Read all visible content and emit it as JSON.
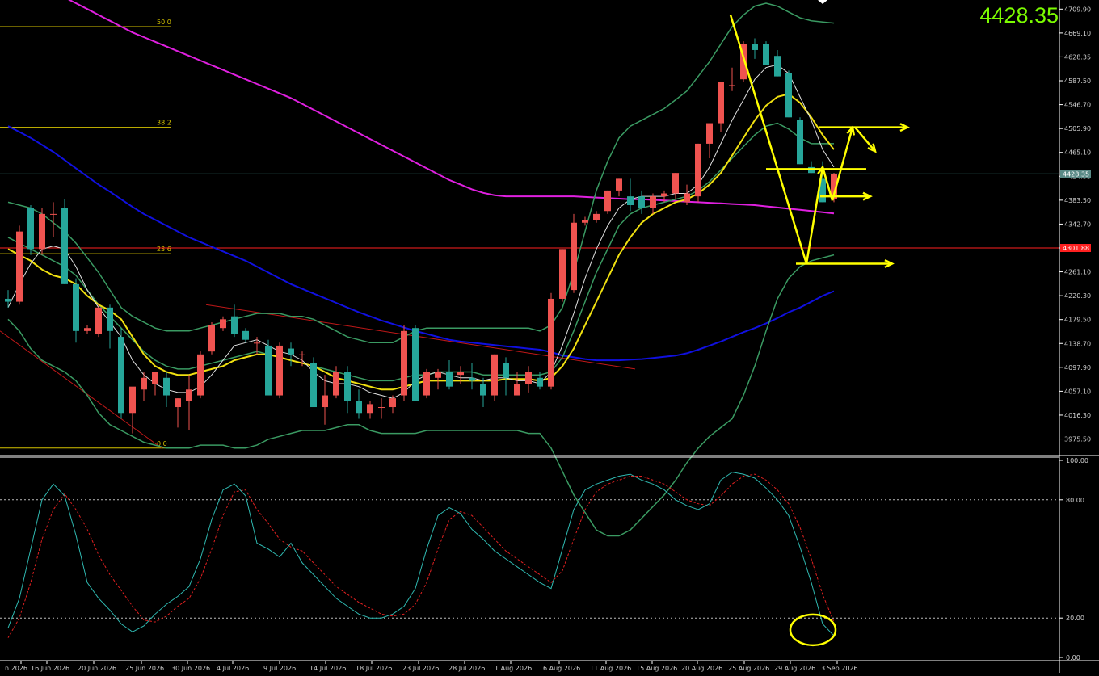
{
  "current_price": "4428.35",
  "chart_data": {
    "type": "candlestick",
    "price_axis": {
      "ticks": [
        "4709.90",
        "4669.10",
        "4628.35",
        "4587.50",
        "4546.70",
        "4505.90",
        "4465.10",
        "4424.35",
        "4383.50",
        "4342.70",
        "4301.90",
        "4261.10",
        "4220.30",
        "4179.50",
        "4138.70",
        "4097.90",
        "4057.10",
        "4016.30",
        "3975.50"
      ],
      "ylim": [
        3950,
        4720
      ]
    },
    "price_markers": {
      "current": {
        "label": "4428.35",
        "value": 4428.35,
        "color": "#4fb3a9"
      },
      "level": {
        "label": "4301.88",
        "value": 4301.88,
        "color": "#ff2020"
      }
    },
    "fib_levels": [
      {
        "label": "50.0",
        "value": 4680
      },
      {
        "label": "38.2",
        "value": 4508
      },
      {
        "label": "23.6",
        "value": 4292
      },
      {
        "label": "0.0",
        "value": 3960
      }
    ],
    "date_labels": [
      "n 2026",
      "16 Jun 2026",
      "20 Jun 2026",
      "25 Jun 2026",
      "30 Jun 2026",
      "4 Jul 2026",
      "9 Jul 2026",
      "14 Jul 2026",
      "18 Jul 2026",
      "23 Jul 2026",
      "28 Jul 2026",
      "1 Aug 2026",
      "6 Aug 2026",
      "11 Aug 2026",
      "15 Aug 2026",
      "20 Aug 2026",
      "25 Aug 2026",
      "29 Aug 2026",
      "3 Sep 2026"
    ],
    "candles": [
      [
        4215,
        4230,
        4200,
        4210
      ],
      [
        4210,
        4340,
        4205,
        4330
      ],
      [
        4370,
        4375,
        4290,
        4300
      ],
      [
        4300,
        4370,
        4290,
        4360
      ],
      [
        4360,
        4380,
        4320,
        4360
      ],
      [
        4370,
        4385,
        4240,
        4240
      ],
      [
        4240,
        4250,
        4140,
        4160
      ],
      [
        4160,
        4170,
        4155,
        4165
      ],
      [
        4155,
        4205,
        4150,
        4200
      ],
      [
        4200,
        4205,
        4130,
        4160
      ],
      [
        4150,
        4165,
        4010,
        4020
      ],
      [
        4020,
        4060,
        3985,
        4065
      ],
      [
        4060,
        4090,
        4040,
        4080
      ],
      [
        4070,
        4090,
        4050,
        4090
      ],
      [
        4080,
        4090,
        4030,
        4050
      ],
      [
        4030,
        4045,
        3995,
        4045
      ],
      [
        4040,
        4085,
        3990,
        4060
      ],
      [
        4050,
        4125,
        4045,
        4120
      ],
      [
        4125,
        4175,
        4120,
        4170
      ],
      [
        4165,
        4185,
        4160,
        4180
      ],
      [
        4185,
        4205,
        4150,
        4155
      ],
      [
        4160,
        4165,
        4140,
        4145
      ],
      [
        4140,
        4150,
        4120,
        4140
      ],
      [
        4135,
        4145,
        4050,
        4050
      ],
      [
        4050,
        4140,
        4045,
        4135
      ],
      [
        4130,
        4140,
        4100,
        4120
      ],
      [
        4120,
        4125,
        4100,
        4120
      ],
      [
        4105,
        4115,
        4030,
        4030
      ],
      [
        4030,
        4085,
        4000,
        4050
      ],
      [
        4050,
        4100,
        4045,
        4090
      ],
      [
        4090,
        4100,
        4020,
        4040
      ],
      [
        4040,
        4060,
        4010,
        4020
      ],
      [
        4020,
        4040,
        4010,
        4035
      ],
      [
        4030,
        4045,
        4010,
        4030
      ],
      [
        4030,
        4050,
        4020,
        4045
      ],
      [
        4050,
        4170,
        4040,
        4160
      ],
      [
        4165,
        4170,
        4040,
        4040
      ],
      [
        4050,
        4095,
        4045,
        4090
      ],
      [
        4080,
        4095,
        4060,
        4090
      ],
      [
        4090,
        4110,
        4060,
        4065
      ],
      [
        4085,
        4100,
        4070,
        4090
      ],
      [
        4080,
        4105,
        4060,
        4075
      ],
      [
        4070,
        4080,
        4030,
        4050
      ],
      [
        4050,
        4120,
        4040,
        4120
      ],
      [
        4105,
        4115,
        4050,
        4080
      ],
      [
        4050,
        4090,
        4050,
        4070
      ],
      [
        4070,
        4100,
        4055,
        4090
      ],
      [
        4080,
        4090,
        4060,
        4065
      ],
      [
        4065,
        4225,
        4060,
        4215
      ],
      [
        4215,
        4300,
        4210,
        4300
      ],
      [
        4230,
        4360,
        4225,
        4345
      ],
      [
        4345,
        4355,
        4340,
        4350
      ],
      [
        4350,
        4365,
        4345,
        4360
      ],
      [
        4365,
        4400,
        4360,
        4400
      ],
      [
        4400,
        4420,
        4390,
        4420
      ],
      [
        4390,
        4420,
        4365,
        4375
      ],
      [
        4390,
        4400,
        4360,
        4370
      ],
      [
        4370,
        4395,
        4360,
        4390
      ],
      [
        4390,
        4400,
        4380,
        4395
      ],
      [
        4395,
        4430,
        4385,
        4430
      ],
      [
        4380,
        4410,
        4375,
        4395
      ],
      [
        4390,
        4480,
        4380,
        4480
      ],
      [
        4480,
        4510,
        4455,
        4515
      ],
      [
        4515,
        4585,
        4500,
        4585
      ],
      [
        4580,
        4610,
        4570,
        4580
      ],
      [
        4590,
        4655,
        4585,
        4650
      ],
      [
        4650,
        4660,
        4625,
        4640
      ],
      [
        4650,
        4655,
        4620,
        4615
      ],
      [
        4630,
        4640,
        4595,
        4595
      ],
      [
        4600,
        4605,
        4525,
        4525
      ],
      [
        4520,
        4525,
        4445,
        4445
      ],
      [
        4440,
        4450,
        4430,
        4430
      ],
      [
        4420,
        4450,
        4380,
        4380
      ],
      [
        4385,
        4430,
        4380,
        4428
      ]
    ],
    "sma_white": [
      4200,
      4240,
      4275,
      4300,
      4305,
      4300,
      4270,
      4230,
      4200,
      4175,
      4150,
      4110,
      4085,
      4070,
      4060,
      4055,
      4055,
      4065,
      4085,
      4110,
      4135,
      4140,
      4145,
      4135,
      4125,
      4120,
      4110,
      4090,
      4075,
      4070,
      4070,
      4065,
      4055,
      4050,
      4045,
      4055,
      4075,
      4085,
      4090,
      4085,
      4080,
      4080,
      4075,
      4080,
      4080,
      4075,
      4075,
      4070,
      4090,
      4135,
      4190,
      4250,
      4300,
      4340,
      4370,
      4385,
      4390,
      4390,
      4390,
      4395,
      4395,
      4410,
      4440,
      4480,
      4520,
      4555,
      4590,
      4610,
      4615,
      4600,
      4560,
      4520,
      4470,
      4440
    ],
    "sma_yellow": [
      4300,
      4290,
      4280,
      4265,
      4255,
      4250,
      4240,
      4220,
      4205,
      4195,
      4180,
      4150,
      4120,
      4100,
      4090,
      4085,
      4085,
      4090,
      4095,
      4100,
      4110,
      4115,
      4120,
      4120,
      4115,
      4110,
      4105,
      4100,
      4090,
      4080,
      4075,
      4070,
      4065,
      4060,
      4060,
      4065,
      4070,
      4075,
      4075,
      4075,
      4075,
      4075,
      4075,
      4075,
      4078,
      4078,
      4078,
      4075,
      4080,
      4100,
      4130,
      4170,
      4210,
      4250,
      4290,
      4320,
      4345,
      4360,
      4370,
      4380,
      4385,
      4395,
      4410,
      4430,
      4460,
      4490,
      4520,
      4545,
      4560,
      4565,
      4550,
      4525,
      4495,
      4470
    ],
    "bb_upper": [
      4380,
      4375,
      4370,
      4360,
      4345,
      4330,
      4310,
      4285,
      4260,
      4230,
      4200,
      4185,
      4175,
      4165,
      4160,
      4160,
      4160,
      4165,
      4170,
      4175,
      4180,
      4185,
      4190,
      4190,
      4190,
      4185,
      4185,
      4180,
      4170,
      4160,
      4150,
      4145,
      4140,
      4140,
      4140,
      4150,
      4160,
      4165,
      4165,
      4165,
      4165,
      4165,
      4165,
      4165,
      4165,
      4165,
      4165,
      4160,
      4170,
      4200,
      4260,
      4330,
      4400,
      4450,
      4490,
      4510,
      4520,
      4530,
      4540,
      4555,
      4570,
      4595,
      4620,
      4650,
      4680,
      4700,
      4715,
      4720,
      4715,
      4705,
      4695,
      4690,
      4688,
      4686
    ],
    "bb_mid": [
      4320,
      4310,
      4300,
      4290,
      4280,
      4270,
      4255,
      4230,
      4205,
      4185,
      4165,
      4145,
      4125,
      4110,
      4100,
      4095,
      4095,
      4100,
      4105,
      4110,
      4115,
      4120,
      4125,
      4120,
      4115,
      4110,
      4105,
      4100,
      4095,
      4090,
      4085,
      4080,
      4075,
      4075,
      4075,
      4080,
      4085,
      4085,
      4090,
      4090,
      4090,
      4090,
      4085,
      4085,
      4085,
      4085,
      4085,
      4085,
      4090,
      4115,
      4160,
      4210,
      4260,
      4300,
      4340,
      4360,
      4370,
      4375,
      4380,
      4385,
      4390,
      4400,
      4415,
      4435,
      4455,
      4475,
      4495,
      4510,
      4515,
      4505,
      4490,
      4480,
      4480,
      4480
    ],
    "bb_lower": [
      4180,
      4160,
      4130,
      4110,
      4100,
      4090,
      4075,
      4050,
      4020,
      4000,
      3990,
      3980,
      3970,
      3965,
      3960,
      3960,
      3960,
      3965,
      3965,
      3965,
      3960,
      3960,
      3965,
      3975,
      3980,
      3985,
      3990,
      3990,
      3990,
      3995,
      4000,
      4000,
      3990,
      3985,
      3985,
      3985,
      3985,
      3990,
      3990,
      3990,
      3990,
      3990,
      3990,
      3990,
      3990,
      3990,
      3985,
      3985,
      3960,
      3920,
      3880,
      3850,
      3820,
      3810,
      3810,
      3820,
      3840,
      3860,
      3880,
      3905,
      3935,
      3960,
      3980,
      3995,
      4010,
      4050,
      4100,
      4160,
      4215,
      4250,
      4270,
      4280,
      4285,
      4290
    ],
    "sma_blue": [
      4510,
      4500,
      4490,
      4478,
      4466,
      4452,
      4438,
      4424,
      4410,
      4398,
      4385,
      4372,
      4360,
      4350,
      4340,
      4330,
      4320,
      4312,
      4304,
      4296,
      4288,
      4280,
      4270,
      4260,
      4250,
      4240,
      4232,
      4224,
      4216,
      4208,
      4200,
      4192,
      4185,
      4178,
      4172,
      4166,
      4160,
      4155,
      4150,
      4145,
      4142,
      4140,
      4138,
      4136,
      4134,
      4132,
      4130,
      4128,
      4124,
      4118,
      4115,
      4112,
      4110,
      4110,
      4110,
      4111,
      4112,
      4114,
      4116,
      4118,
      4122,
      4128,
      4135,
      4142,
      4150,
      4158,
      4165,
      4173,
      4182,
      4192,
      4200,
      4210,
      4220,
      4228
    ],
    "sma_magenta": [
      4780,
      4770,
      4760,
      4750,
      4740,
      4730,
      4720,
      4710,
      4700,
      4690,
      4680,
      4670,
      4662,
      4654,
      4646,
      4638,
      4630,
      4622,
      4614,
      4606,
      4598,
      4590,
      4582,
      4574,
      4566,
      4558,
      4548,
      4538,
      4528,
      4518,
      4508,
      4498,
      4488,
      4478,
      4468,
      4458,
      4448,
      4438,
      4428,
      4418,
      4410,
      4402,
      4396,
      4392,
      4390,
      4390,
      4390,
      4390,
      4390,
      4390,
      4390,
      4389,
      4388,
      4387,
      4386,
      4385,
      4385,
      4384,
      4383,
      4382,
      4381,
      4380,
      4379,
      4378,
      4377,
      4376,
      4375,
      4373,
      4371,
      4369,
      4367,
      4365,
      4363,
      4361
    ],
    "trendline_label": "",
    "oscillator": {
      "type": "stochastic",
      "ticks": [
        "100.00",
        "80.00",
        "20.00",
        "0.00"
      ],
      "ylim": [
        0,
        100
      ],
      "levels": [
        80,
        20
      ],
      "k": [
        15,
        30,
        55,
        80,
        88,
        82,
        62,
        38,
        30,
        24,
        17,
        13,
        16,
        22,
        27,
        31,
        36,
        50,
        70,
        85,
        88,
        82,
        58,
        55,
        51,
        58,
        48,
        42,
        36,
        30,
        26,
        22,
        20,
        20,
        22,
        26,
        35,
        55,
        72,
        76,
        73,
        65,
        60,
        54,
        50,
        46,
        42,
        38,
        35,
        55,
        75,
        85,
        88,
        90,
        92,
        93,
        90,
        88,
        85,
        80,
        77,
        75,
        78,
        90,
        94,
        93,
        91,
        86,
        80,
        72,
        56,
        38,
        17,
        11
      ],
      "d": [
        10,
        20,
        38,
        60,
        75,
        83,
        75,
        65,
        52,
        42,
        34,
        26,
        19,
        18,
        21,
        26,
        30,
        40,
        55,
        72,
        84,
        85,
        75,
        68,
        60,
        56,
        54,
        48,
        42,
        36,
        32,
        28,
        25,
        22,
        21,
        22,
        27,
        38,
        55,
        70,
        74,
        72,
        66,
        60,
        54,
        50,
        46,
        42,
        38,
        44,
        60,
        75,
        84,
        88,
        90,
        92,
        92,
        90,
        88,
        84,
        80,
        78,
        77,
        82,
        88,
        92,
        93,
        90,
        85,
        78,
        66,
        50,
        32,
        18
      ]
    }
  }
}
